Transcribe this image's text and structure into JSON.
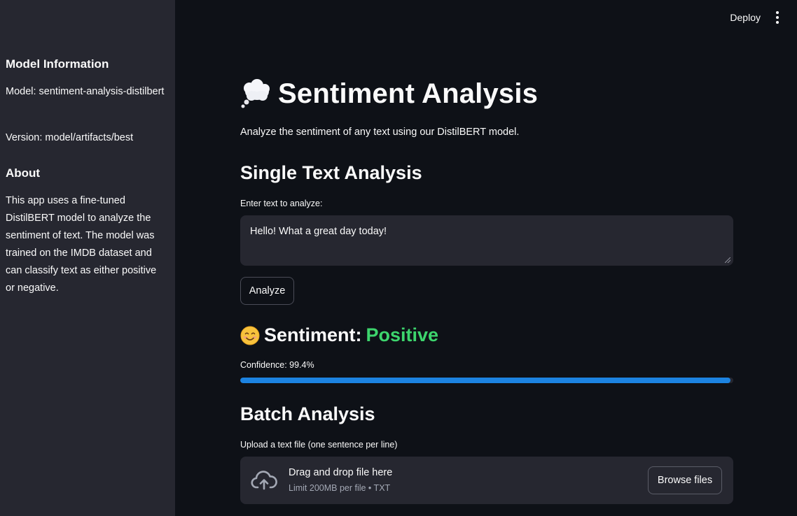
{
  "header": {
    "deploy_label": "Deploy"
  },
  "sidebar": {
    "model_heading": "Model Information",
    "model_line": "Model: sentiment-analysis-distilbert",
    "version_line": "Version: model/artifacts/best",
    "about_heading": "About",
    "about_text": "This app uses a fine-tuned DistilBERT model to analyze the sentiment of text. The model was trained on the IMDB dataset and can classify text as either positive or negative."
  },
  "main": {
    "title": "Sentiment Analysis",
    "title_icon": "thought-balloon-icon",
    "subtitle": "Analyze the sentiment of any text using our DistilBERT model.",
    "single": {
      "heading": "Single Text Analysis",
      "input_label": "Enter text to analyze:",
      "input_value": "Hello! What a great day today!",
      "analyze_label": "Analyze"
    },
    "result": {
      "emoji_icon": "smiling-face-icon",
      "sentiment_prefix": "Sentiment: ",
      "sentiment_value": "Positive",
      "sentiment_color": "#3dd56d",
      "confidence_text": "Confidence: 99.4%",
      "confidence_fraction": 0.994,
      "progress_color": "#1c83e1"
    },
    "batch": {
      "heading": "Batch Analysis",
      "upload_label": "Upload a text file (one sentence per line)",
      "dropzone_title": "Drag and drop file here",
      "dropzone_limit": "Limit 200MB per file • TXT",
      "browse_label": "Browse files"
    }
  }
}
